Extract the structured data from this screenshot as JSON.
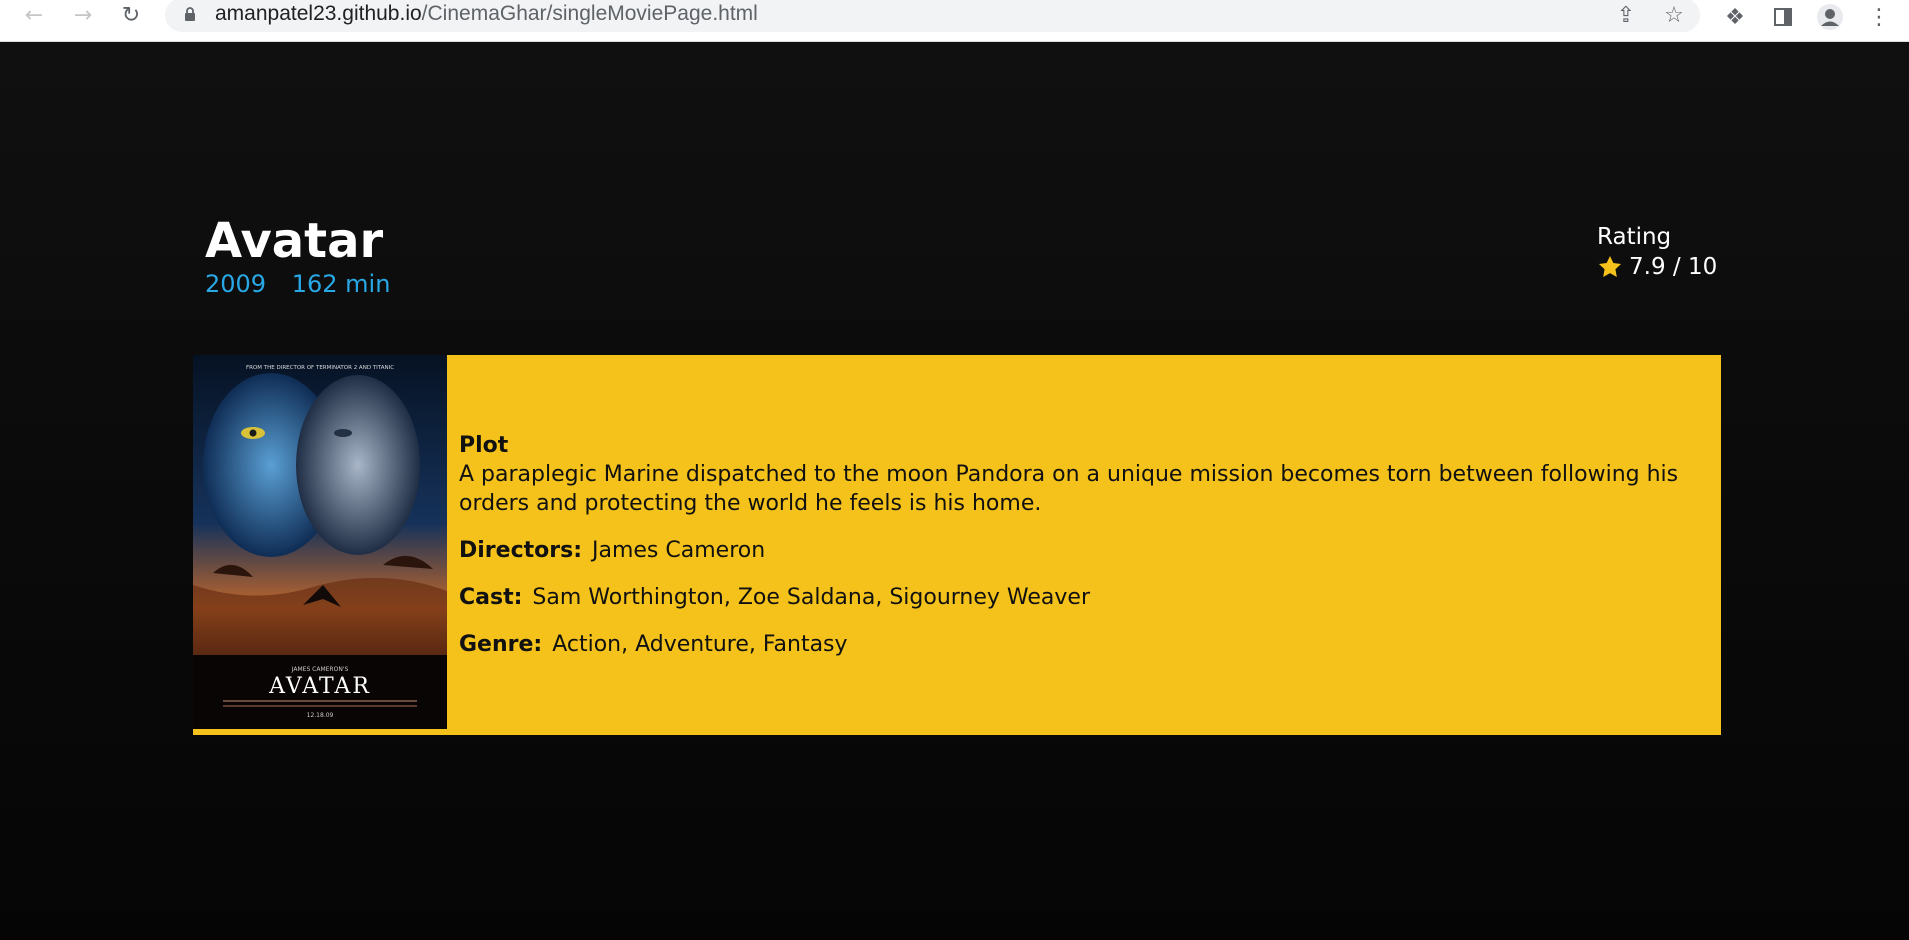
{
  "browser": {
    "url_host": "amanpatel23.github.io",
    "url_path": "/CinemaGhar/singleMoviePage.html",
    "icons": [
      "back-icon",
      "forward-icon",
      "reload-icon",
      "lock-icon",
      "share-icon",
      "bookmark-star-icon",
      "extensions-icon",
      "side-panel-icon",
      "profile-icon",
      "menu-icon"
    ]
  },
  "movie": {
    "title": "Avatar",
    "year": "2009",
    "runtime": "162 min",
    "rating_label": "Rating",
    "rating_value": "7.9 / 10",
    "poster": {
      "tagline": "FROM THE DIRECTOR OF TERMINATOR 2 AND TITANIC",
      "credit": "JAMES CAMERON'S",
      "title": "AVATAR",
      "date": "12.18.09"
    },
    "plot_heading": "Plot",
    "plot": "A paraplegic Marine dispatched to the moon Pandora on a unique mission becomes torn between following his orders and protecting the world he feels is his home.",
    "directors_label": "Directors:",
    "directors": "James Cameron",
    "cast_label": "Cast:",
    "cast": "Sam Worthington, Zoe Saldana, Sigourney Weaver",
    "genre_label": "Genre:",
    "genre": "Action, Adventure, Fantasy"
  },
  "colors": {
    "card_background": "#f4c21a",
    "meta_blue": "#29a8e6",
    "star": "#f4c21a",
    "page_background": "#0a0a0a"
  }
}
